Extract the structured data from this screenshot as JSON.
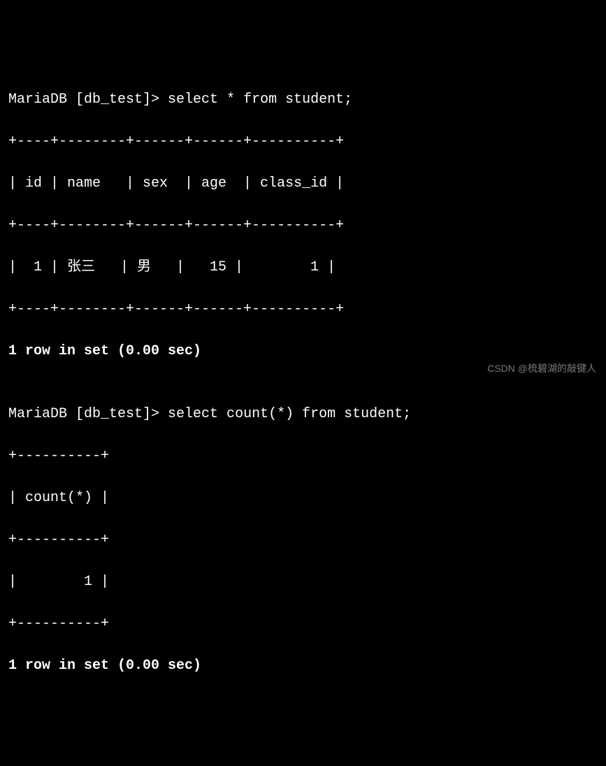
{
  "query1": {
    "prompt": "MariaDB [db_test]> ",
    "command": "select * from student;",
    "border_top": "+----+--------+------+------+----------+",
    "header_row": "| id | name   | sex  | age  | class_id |",
    "border_mid": "+----+--------+------+------+----------+",
    "data_row": "|  1 | 张三   | 男   |   15 |        1 |",
    "border_bottom": "+----+--------+------+------+----------+",
    "summary": "1 row in set (0.00 sec)"
  },
  "blank": "",
  "query2": {
    "prompt": "MariaDB [db_test]> ",
    "command": "select count(*) from student;",
    "border_top": "+----------+",
    "header_row": "| count(*) |",
    "border_mid": "+----------+",
    "data_row": "|        1 |",
    "border_bottom": "+----------+",
    "summary": "1 row in set (0.00 sec)"
  },
  "watermark": "CSDN @梳碧湖的敲键人"
}
